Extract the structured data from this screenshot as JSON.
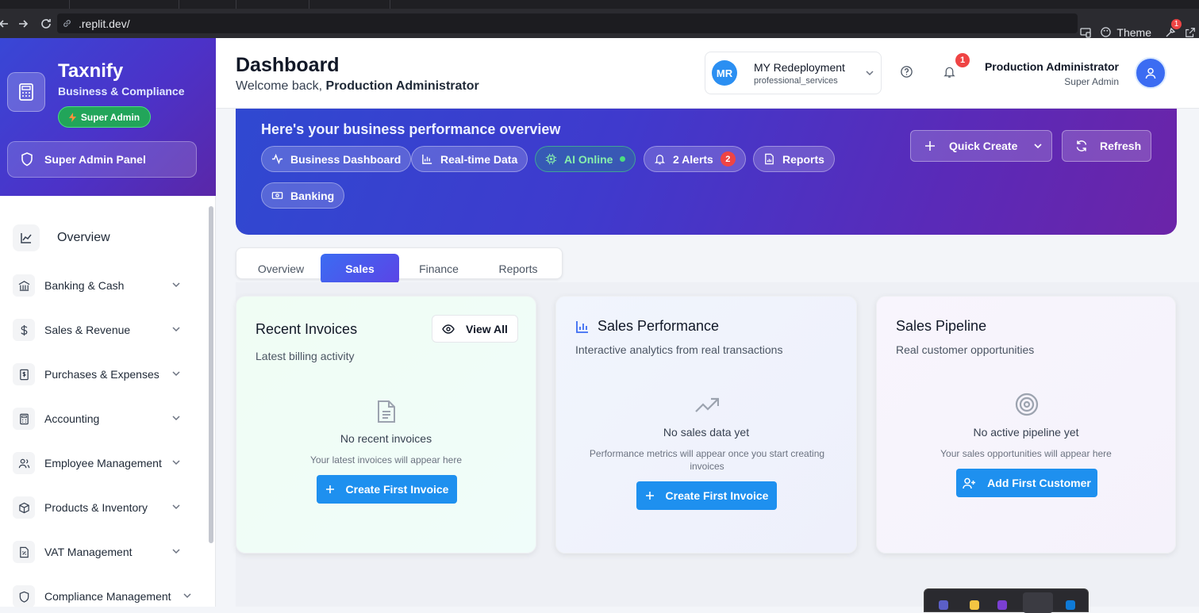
{
  "browser": {
    "url_prefix": "",
    "url": ".replit.dev/",
    "theme_label": "Theme",
    "extension_badge": "1"
  },
  "sidebar": {
    "brand_name": "Taxnify",
    "brand_subtitle": "Business & Compliance",
    "role_badge": "Super Admin",
    "panel_button": "Super Admin Panel",
    "items": [
      {
        "label": "Overview",
        "icon": "chart-line-icon"
      },
      {
        "label": "Banking & Cash",
        "icon": "bank-icon"
      },
      {
        "label": "Sales & Revenue",
        "icon": "dollar-icon"
      },
      {
        "label": "Purchases & Expenses",
        "icon": "receipt-icon"
      },
      {
        "label": "Accounting",
        "icon": "calculator-icon"
      },
      {
        "label": "Employee Management",
        "icon": "users-icon"
      },
      {
        "label": "Products & Inventory",
        "icon": "box-icon"
      },
      {
        "label": "VAT Management",
        "icon": "file-percent-icon"
      },
      {
        "label": "Compliance Management",
        "icon": "shield-icon"
      }
    ]
  },
  "header": {
    "title": "Dashboard",
    "welcome_prefix": "Welcome back, ",
    "welcome_name": "Production Administrator",
    "workspace": {
      "initials": "MR",
      "name": "MY Redeployment",
      "type": "professional_services"
    },
    "notification_count": "1",
    "user_name": "Production Administrator",
    "user_role": "Super Admin"
  },
  "hero": {
    "subtitle": "Here's your business performance overview",
    "chips": [
      "Business Dashboard",
      "Real-time Data",
      "AI Online",
      "2 Alerts",
      "Reports",
      "Banking"
    ],
    "alert_count": "2",
    "quick_create": "Quick Create",
    "refresh": "Refresh"
  },
  "tabs": [
    "Overview",
    "Sales",
    "Finance",
    "Reports"
  ],
  "active_tab": "Sales",
  "cards": {
    "invoices": {
      "title": "Recent Invoices",
      "subtitle": "Latest billing activity",
      "view_all": "View All",
      "empty_title": "No recent invoices",
      "empty_desc": "Your latest invoices will appear here",
      "button": "Create First Invoice"
    },
    "performance": {
      "title": "Sales Performance",
      "subtitle": "Interactive analytics from real transactions",
      "empty_title": "No sales data yet",
      "empty_desc": "Performance metrics will appear once you start creating invoices",
      "button": "Create First Invoice"
    },
    "pipeline": {
      "title": "Sales Pipeline",
      "subtitle": "Real customer opportunities",
      "empty_title": "No active pipeline yet",
      "empty_desc": "Your sales opportunities will appear here",
      "button": "Add First Customer"
    }
  },
  "colors": {
    "primary": "#1e90ef",
    "brand_gradient_start": "#3847d6",
    "brand_gradient_end": "#6b24a8",
    "success": "#22a55a",
    "danger": "#ef4444"
  }
}
